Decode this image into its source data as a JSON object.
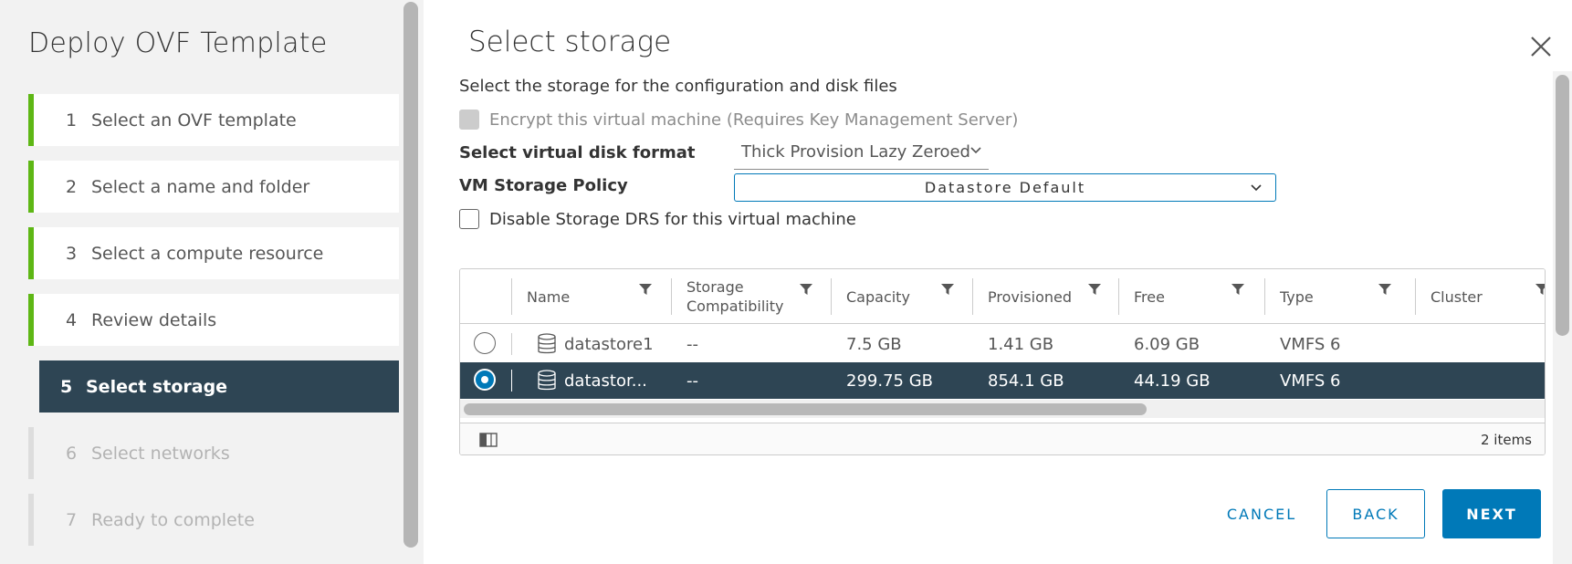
{
  "wizard": {
    "title": "Deploy OVF Template",
    "steps": [
      {
        "num": "1",
        "label": "Select an OVF template"
      },
      {
        "num": "2",
        "label": "Select a name and folder"
      },
      {
        "num": "3",
        "label": "Select a compute resource"
      },
      {
        "num": "4",
        "label": "Review details"
      },
      {
        "num": "5",
        "label": "Select storage"
      },
      {
        "num": "6",
        "label": "Select networks"
      },
      {
        "num": "7",
        "label": "Ready to complete"
      }
    ]
  },
  "page": {
    "title": "Select storage",
    "description": "Select the storage for the configuration and disk files",
    "encrypt_label": "Encrypt this virtual machine (Requires Key Management Server)",
    "disk_format_label": "Select virtual disk format",
    "disk_format_value": "Thick Provision Lazy Zeroed",
    "policy_label": "VM Storage Policy",
    "policy_value": "Datastore Default",
    "disable_drs_label": "Disable Storage DRS for this virtual machine"
  },
  "grid": {
    "columns": [
      "Name",
      "Storage Compatibility",
      "Capacity",
      "Provisioned",
      "Free",
      "Type",
      "Cluster"
    ],
    "column_line1": "Storage",
    "column_line2": "Compatibility",
    "rows": [
      {
        "name": "datastore1",
        "compat": "--",
        "capacity": "7.5 GB",
        "provisioned": "1.41 GB",
        "free": "6.09 GB",
        "type": "VMFS 6",
        "cluster": "",
        "selected": false
      },
      {
        "name": "datastor...",
        "compat": "--",
        "capacity": "299.75 GB",
        "provisioned": "854.1 GB",
        "free": "44.19 GB",
        "type": "VMFS 6",
        "cluster": "",
        "selected": true
      }
    ],
    "footer_count": "2 items"
  },
  "buttons": {
    "cancel": "CANCEL",
    "back": "BACK",
    "next": "NEXT"
  },
  "colors": {
    "accent": "#0079b8",
    "active_step": "#2e4554",
    "complete_bar": "#5eb715"
  },
  "icons": {
    "close": "close-icon",
    "filter": "filter-icon",
    "datastore": "database-icon",
    "chevron": "chevron-down-icon",
    "column_toggle": "column-toggle-icon"
  }
}
